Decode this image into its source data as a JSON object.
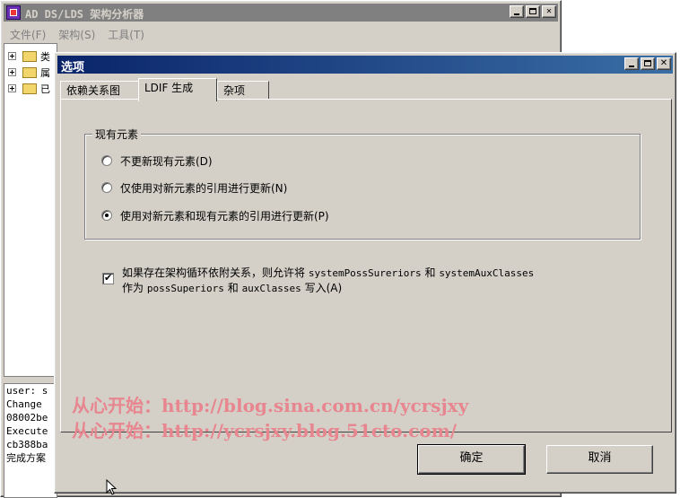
{
  "app": {
    "title": "AD DS/LDS 架构分析器",
    "menu": [
      "文件(F)",
      "架构(S)",
      "工具(T)"
    ],
    "tree_partial_labels": [
      "类",
      "属",
      "已"
    ],
    "log_lines": [
      "user: s",
      "Change",
      "08002be",
      "Execute",
      "cb388ba",
      "完成方案"
    ]
  },
  "dialog": {
    "title": "选项",
    "tabs": [
      {
        "label": "依赖关系图",
        "active": false
      },
      {
        "label": "LDIF 生成",
        "active": true
      },
      {
        "label": "杂项",
        "active": false
      }
    ],
    "group": {
      "legend": "现有元素",
      "options": [
        {
          "label": "不更新现有元素(D)",
          "selected": false
        },
        {
          "label": "仅使用对新元素的引用进行更新(N)",
          "selected": false
        },
        {
          "label": "使用对新元素和现有元素的引用进行更新(P)",
          "selected": true
        }
      ]
    },
    "checkbox": {
      "checked": true,
      "line1_prefix": "如果存在架构循环依附关系，则允许将 ",
      "line1_code1": "systemPossSureriors",
      "line1_mid": " 和 ",
      "line1_code2": "systemAuxClasses",
      "line2_prefix": "作为 ",
      "line2_code1": "possSuperiors",
      "line2_mid": " 和 ",
      "line2_code2": "auxClasses",
      "line2_suffix": " 写入(A)"
    },
    "ok_label": "确定",
    "cancel_label": "取消"
  },
  "watermark": {
    "line1": "从心开始：http://blog.sina.com.cn/ycrsjxy",
    "line2": "从心开始：http://ycrsjxy.blog.51cto.com/"
  },
  "colors": {
    "face": "#d4d0c8",
    "title_active": "#0a246a",
    "title_inactive": "#808080",
    "watermark": "#e8868f"
  }
}
